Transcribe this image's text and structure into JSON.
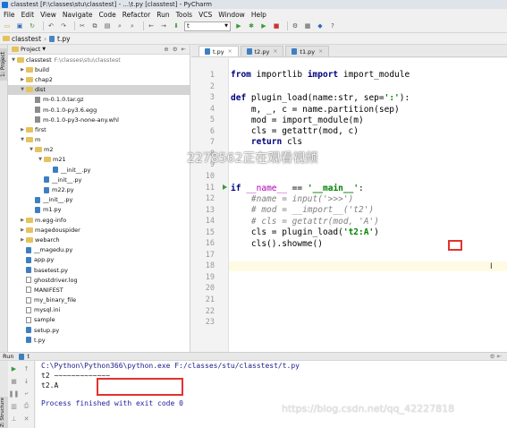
{
  "window": {
    "title": "classtest [F:\\classes\\stu\\classtest] - ...\\t.py [classtest] - PyCharm"
  },
  "menu": [
    "File",
    "Edit",
    "View",
    "Navigate",
    "Code",
    "Refactor",
    "Run",
    "Tools",
    "VCS",
    "Window",
    "Help"
  ],
  "toolbar": {
    "run_config": "t"
  },
  "breadcrumb": {
    "project": "classtest",
    "file": "t.py"
  },
  "project_panel": {
    "header": "Project",
    "tree": [
      {
        "label": "classtest",
        "path": "F:\\classes\\stu\\classtest",
        "icon": "folder"
      },
      {
        "label": "build",
        "icon": "folder"
      },
      {
        "label": "chap2",
        "icon": "folder"
      },
      {
        "label": "dist",
        "icon": "folder"
      },
      {
        "label": "m-0.1.0.tar.gz",
        "icon": "archive"
      },
      {
        "label": "m-0.1.0-py3.6.egg",
        "icon": "archive"
      },
      {
        "label": "m-0.1.0-py3-none-any.whl",
        "icon": "archive"
      },
      {
        "label": "first",
        "icon": "folder"
      },
      {
        "label": "m",
        "icon": "folder"
      },
      {
        "label": "m2",
        "icon": "folder"
      },
      {
        "label": "m21",
        "icon": "folder"
      },
      {
        "label": "__init__.py",
        "icon": "python"
      },
      {
        "label": "__init__.py",
        "icon": "python"
      },
      {
        "label": "m22.py",
        "icon": "python"
      },
      {
        "label": "__init__.py",
        "icon": "python"
      },
      {
        "label": "m1.py",
        "icon": "python"
      },
      {
        "label": "m.egg-info",
        "icon": "folder"
      },
      {
        "label": "magedouspider",
        "icon": "folder"
      },
      {
        "label": "webarch",
        "icon": "folder"
      },
      {
        "label": "__magedu.py",
        "icon": "python"
      },
      {
        "label": "app.py",
        "icon": "python"
      },
      {
        "label": "basetest.py",
        "icon": "python"
      },
      {
        "label": "ghostdriver.log",
        "icon": "text"
      },
      {
        "label": "MANIFEST",
        "icon": "text"
      },
      {
        "label": "my_binary_file",
        "icon": "text"
      },
      {
        "label": "mysql.ini",
        "icon": "text"
      },
      {
        "label": "sample",
        "icon": "text"
      },
      {
        "label": "setup.py",
        "icon": "python"
      },
      {
        "label": "t.py",
        "icon": "python"
      }
    ]
  },
  "editor": {
    "tabs": [
      {
        "label": "t.py",
        "active": true
      },
      {
        "label": "t2.py",
        "active": false
      },
      {
        "label": "t1.py",
        "active": false
      }
    ],
    "line_numbers": [
      "1",
      "2",
      "3",
      "4",
      "5",
      "6",
      "7",
      "8",
      "9",
      "10",
      "11",
      "12",
      "13",
      "14",
      "15",
      "16",
      "17",
      "18",
      "19",
      "20",
      "21",
      "22",
      "23"
    ],
    "code": {
      "l1_kw1": "from",
      "l1_a": " importlib ",
      "l1_kw2": "import",
      "l1_b": " import_module",
      "l3_kw": "def",
      "l3_a": " plugin_load(name:str, sep=",
      "l3_str": "':'",
      "l3_b": "):",
      "l4": "    m, _, c = name.partition(sep)",
      "l5": "    mod = import_module(m)",
      "l6": "    cls = getattr(mod, c)",
      "l7_ind": "    ",
      "l7_kw": "return",
      "l7_a": " cls",
      "l11_kw": "if",
      "l11_a": " ",
      "l11_d": "__name__",
      "l11_b": " == ",
      "l11_str": "'__main__'",
      "l11_c": ":",
      "l12": "    #name = input('>>>')",
      "l13": "    # mod = __import__('t2')",
      "l14": "    # cls = getattr(mod, 'A')",
      "l15_a": "    cls = plugin_load(",
      "l15_str": "'t2:A'",
      "l15_b": ")",
      "l16": "    cls().showme()"
    }
  },
  "overlay": {
    "watermark": "2278562正在观看视频",
    "csdn": "https://blog.csdn.net/qq_42227818"
  },
  "run_panel": {
    "header": "Run",
    "tab": "t",
    "lines": [
      "C:\\Python\\Python366\\python.exe F:/classes/stu/classtest/t.py",
      "t2 ~~~~~~~~~~~~~",
      "t2.A",
      "",
      "Process finished with exit code 0"
    ]
  },
  "colors": {
    "highlight_box": "#e3322f",
    "run_arrow": "#3a9a3a",
    "keyword": "#000080",
    "string": "#008000"
  }
}
